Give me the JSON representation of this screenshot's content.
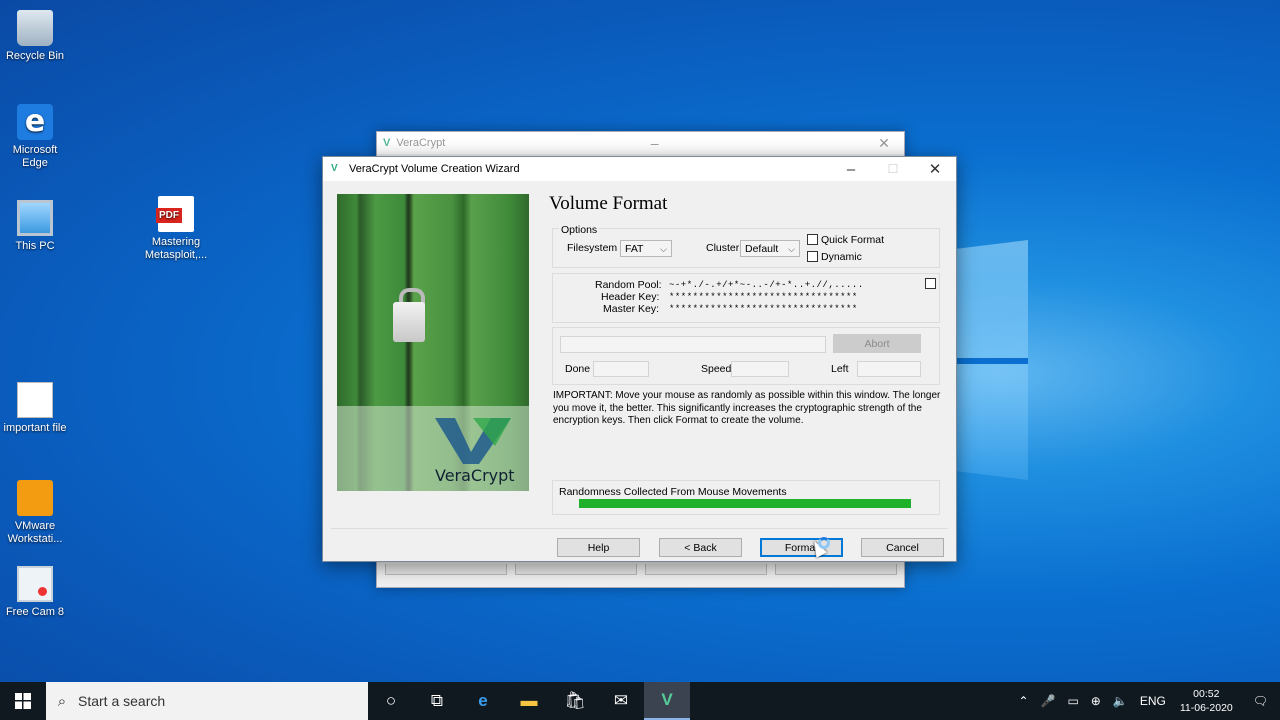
{
  "desktop": {
    "icons": [
      {
        "label": "Recycle Bin"
      },
      {
        "label": "Microsoft Edge"
      },
      {
        "label": "This PC"
      },
      {
        "label": "Mastering Metasploit,..."
      },
      {
        "label": "important file"
      },
      {
        "label": "VMware Workstati..."
      },
      {
        "label": "Free Cam 8"
      }
    ]
  },
  "back_window": {
    "title": "VeraCrypt"
  },
  "wizard": {
    "title": "VeraCrypt Volume Creation Wizard",
    "brand": "VeraCrypt",
    "heading": "Volume Format",
    "options_label": "Options",
    "filesystem_label": "Filesystem",
    "filesystem_value": "FAT",
    "cluster_label": "Cluster",
    "cluster_value": "Default",
    "quick_format_label": "Quick Format",
    "dynamic_label": "Dynamic",
    "random_pool_label": "Random Pool:",
    "random_pool_value": "~-+*./-.+/+*~-..-/+-*..+.//,.....",
    "header_key_label": "Header Key:",
    "header_key_value": "********************************",
    "master_key_label": "Master Key:",
    "master_key_value": "********************************",
    "abort_label": "Abort",
    "done_label": "Done",
    "speed_label": "Speed",
    "left_label": "Left",
    "important_text": "IMPORTANT: Move your mouse as randomly as possible within this window. The longer you move it, the better. This significantly increases the cryptographic strength of the encryption keys. Then click Format to create the volume.",
    "randomness_label": "Randomness Collected From Mouse Movements",
    "randomness_progress": 1.0,
    "buttons": {
      "help": "Help",
      "back": "< Back",
      "format": "Format",
      "cancel": "Cancel"
    }
  },
  "taskbar": {
    "search_placeholder": "Start a search",
    "language": "ENG",
    "time": "00:52",
    "date": "11-06-2020"
  }
}
